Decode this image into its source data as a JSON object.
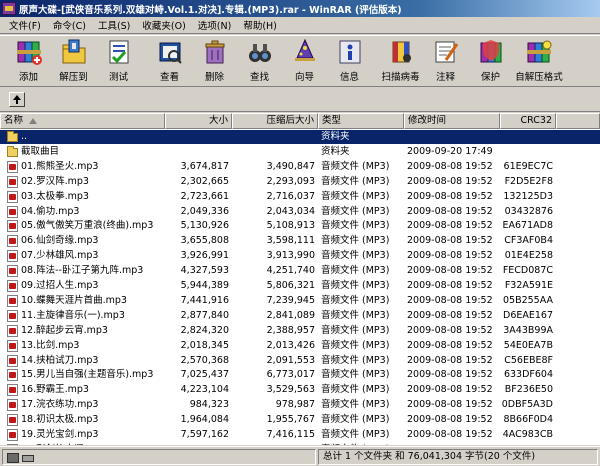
{
  "window": {
    "title": "原声大碟-[武侠音乐系列.双雄对峙.Vol.1.对决].专辑.(MP3).rar - WinRAR (评估版本)"
  },
  "menu": [
    "文件(F)",
    "命令(C)",
    "工具(S)",
    "收藏夹(O)",
    "选项(N)",
    "帮助(H)"
  ],
  "toolbar": [
    {
      "label": "添加",
      "icon": "add-books-icon"
    },
    {
      "label": "解压到",
      "icon": "extract-folder-icon"
    },
    {
      "label": "测试",
      "icon": "test-icon"
    },
    {
      "label": "查看",
      "icon": "view-book-icon"
    },
    {
      "label": "删除",
      "icon": "delete-icon"
    },
    {
      "label": "查找",
      "icon": "find-binoculars-icon"
    },
    {
      "label": "向导",
      "icon": "wizard-icon"
    },
    {
      "label": "信息",
      "icon": "info-icon"
    },
    {
      "label": "扫描病毒",
      "icon": "virus-scan-icon"
    },
    {
      "label": "注释",
      "icon": "comment-icon"
    },
    {
      "label": "保护",
      "icon": "protect-icon"
    },
    {
      "label": "自解压格式",
      "icon": "sfx-icon"
    }
  ],
  "columns": {
    "name": "名称",
    "size": "大小",
    "packed": "压缩后大小",
    "type": "类型",
    "modified": "修改时间",
    "crc": "CRC32"
  },
  "rows": [
    {
      "name": "..",
      "size": "",
      "packed": "",
      "type": "资料夹",
      "modified": "",
      "crc": "",
      "kind": "folder",
      "selected": true
    },
    {
      "name": "截取曲目",
      "size": "",
      "packed": "",
      "type": "资料夹",
      "modified": "2009-09-20 17:49",
      "crc": "",
      "kind": "folder"
    },
    {
      "name": "01.熊熊圣火.mp3",
      "size": "3,674,817",
      "packed": "3,490,847",
      "type": "音频文件 (MP3)",
      "modified": "2009-08-08 19:52",
      "crc": "61E9EC7C",
      "kind": "mp3"
    },
    {
      "name": "02.罗汉阵.mp3",
      "size": "2,302,665",
      "packed": "2,293,093",
      "type": "音频文件 (MP3)",
      "modified": "2009-08-08 19:52",
      "crc": "F2D5E2F8",
      "kind": "mp3"
    },
    {
      "name": "03.太极拳.mp3",
      "size": "2,723,661",
      "packed": "2,716,037",
      "type": "音频文件 (MP3)",
      "modified": "2009-08-08 19:52",
      "crc": "132125D3",
      "kind": "mp3"
    },
    {
      "name": "04.偷功.mp3",
      "size": "2,049,336",
      "packed": "2,043,034",
      "type": "音频文件 (MP3)",
      "modified": "2009-08-08 19:52",
      "crc": "03432876",
      "kind": "mp3"
    },
    {
      "name": "05.傲气傲笑万重浪(终曲).mp3",
      "size": "5,130,926",
      "packed": "5,108,913",
      "type": "音频文件 (MP3)",
      "modified": "2009-08-08 19:52",
      "crc": "EA671AD8",
      "kind": "mp3"
    },
    {
      "name": "06.仙剑奇缘.mp3",
      "size": "3,655,808",
      "packed": "3,598,111",
      "type": "音频文件 (MP3)",
      "modified": "2009-08-08 19:52",
      "crc": "CF3AF0B4",
      "kind": "mp3"
    },
    {
      "name": "07.少林雄风.mp3",
      "size": "3,926,991",
      "packed": "3,913,990",
      "type": "音频文件 (MP3)",
      "modified": "2009-08-08 19:52",
      "crc": "01E4E258",
      "kind": "mp3"
    },
    {
      "name": "08.阵法--卧江子第九阵.mp3",
      "size": "4,327,593",
      "packed": "4,251,740",
      "type": "音频文件 (MP3)",
      "modified": "2009-08-08 19:52",
      "crc": "FECD087C",
      "kind": "mp3"
    },
    {
      "name": "09.过招人生.mp3",
      "size": "5,944,389",
      "packed": "5,806,321",
      "type": "音频文件 (MP3)",
      "modified": "2009-08-08 19:52",
      "crc": "F32A591E",
      "kind": "mp3"
    },
    {
      "name": "10.蝶舞天涯片首曲.mp3",
      "size": "7,441,916",
      "packed": "7,239,945",
      "type": "音频文件 (MP3)",
      "modified": "2009-08-08 19:52",
      "crc": "05B255AA",
      "kind": "mp3"
    },
    {
      "name": "11.主旋律音乐(一).mp3",
      "size": "2,877,840",
      "packed": "2,841,089",
      "type": "音频文件 (MP3)",
      "modified": "2009-08-08 19:52",
      "crc": "D6EAE167",
      "kind": "mp3"
    },
    {
      "name": "12.醉起步云宵.mp3",
      "size": "2,824,320",
      "packed": "2,388,957",
      "type": "音频文件 (MP3)",
      "modified": "2009-08-08 19:52",
      "crc": "3A43B99A",
      "kind": "mp3"
    },
    {
      "name": "13.比剑.mp3",
      "size": "2,018,345",
      "packed": "2,013,426",
      "type": "音频文件 (MP3)",
      "modified": "2009-08-08 19:52",
      "crc": "54E0EA7B",
      "kind": "mp3"
    },
    {
      "name": "14.挟柏试刀.mp3",
      "size": "2,570,368",
      "packed": "2,091,553",
      "type": "音频文件 (MP3)",
      "modified": "2009-08-08 19:52",
      "crc": "C56EBE8F",
      "kind": "mp3"
    },
    {
      "name": "15.男儿当自强(主题音乐).mp3",
      "size": "7,025,437",
      "packed": "6,773,017",
      "type": "音频文件 (MP3)",
      "modified": "2009-08-08 19:52",
      "crc": "633DF604",
      "kind": "mp3"
    },
    {
      "name": "16.野霸王.mp3",
      "size": "4,223,104",
      "packed": "3,529,563",
      "type": "音频文件 (MP3)",
      "modified": "2009-08-08 19:52",
      "crc": "BF236E50",
      "kind": "mp3"
    },
    {
      "name": "17.浣衣练功.mp3",
      "size": "984,323",
      "packed": "978,987",
      "type": "音频文件 (MP3)",
      "modified": "2009-08-08 19:52",
      "crc": "0DBF5A3D",
      "kind": "mp3"
    },
    {
      "name": "18.初识太极.mp3",
      "size": "1,964,084",
      "packed": "1,955,767",
      "type": "音频文件 (MP3)",
      "modified": "2009-08-08 19:52",
      "crc": "8B66F0D4",
      "kind": "mp3"
    },
    {
      "name": "19.灵光宝剑.mp3",
      "size": "7,597,162",
      "packed": "7,416,115",
      "type": "音频文件 (MP3)",
      "modified": "2009-08-08 19:52",
      "crc": "4AC983CB",
      "kind": "mp3"
    },
    {
      "name": "20.彩剑竹水瓶.mp3",
      "size": "2,778,219",
      "packed": "2,713,926",
      "type": "音频文件 (MP3)",
      "modified": "2009-08-08 19:52",
      "crc": "EC4634FE",
      "kind": "mp3"
    }
  ],
  "status": {
    "left": "",
    "right": "总计 1 个文件夹 和 76,041,304 字节(20 个文件)"
  }
}
